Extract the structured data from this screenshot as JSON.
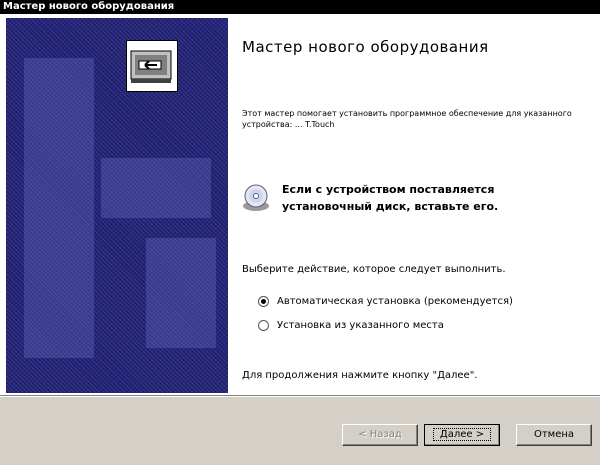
{
  "window": {
    "title": "Мастер нового оборудования"
  },
  "main": {
    "heading": "Мастер нового оборудования",
    "intro": "Этот мастер помогает установить программное обеспечение для указанного устройства: ... T.Touch",
    "disk_hint": "Если с устройством поставляется установочный диск, вставьте его.",
    "prompt": "Выберите действие, которое следует выполнить.",
    "options": [
      {
        "label": "Автоматическая установка (рекомендуется)",
        "checked": true
      },
      {
        "label": "Установка из указанного места",
        "checked": false
      }
    ],
    "continue_hint": "Для продолжения нажмите кнопку \"Далее\"."
  },
  "buttons": {
    "back": "< Назад",
    "next": "Далее >",
    "cancel": "Отмена"
  },
  "icons": {
    "wizard": "hardware-wizard-icon",
    "disk": "cd-disk-icon"
  }
}
